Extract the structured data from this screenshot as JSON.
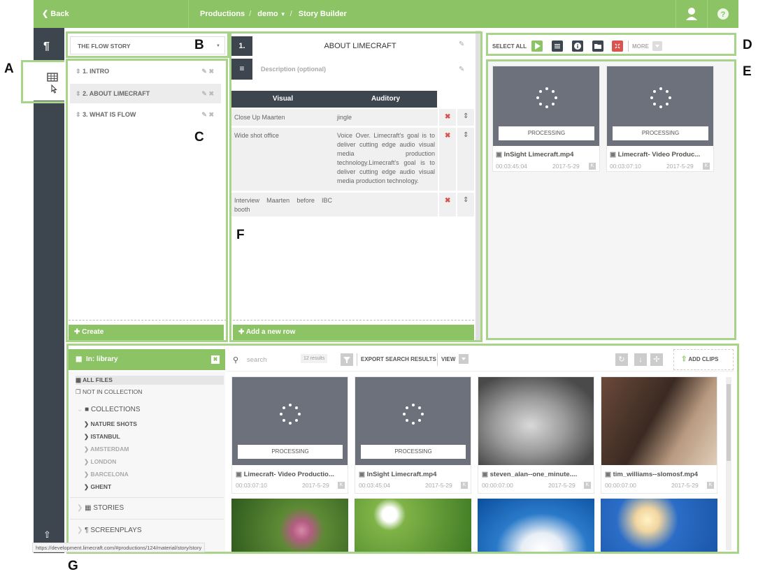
{
  "topbar": {
    "back": "Back",
    "crumb1": "Productions",
    "crumb2": "demo",
    "crumb3": "Story Builder"
  },
  "labels": {
    "A": "A",
    "B": "B",
    "C": "C",
    "D": "D",
    "E": "E",
    "F": "F",
    "G": "G"
  },
  "story_select": {
    "value": "THE FLOW STORY"
  },
  "stories": [
    {
      "label": "1. INTRO"
    },
    {
      "label": "2. ABOUT LIMECRAFT"
    },
    {
      "label": "3. WHAT IS FLOW"
    }
  ],
  "story_create": "Create",
  "scene": {
    "number": "1.",
    "title": "ABOUT LIMECRAFT",
    "desc_placeholder": "Description (optional)"
  },
  "table": {
    "headers": [
      "Visual",
      "Auditory"
    ],
    "rows": [
      {
        "visual": "Close Up Maarten",
        "auditory": "jingle"
      },
      {
        "visual": "Wide shot office",
        "auditory": "Voice Over. Limecraft's goal is to deliver cutting edge audio visual media production technology.Limecraft's goal is to deliver cutting edge audio visual media production technology."
      },
      {
        "visual": "Interview Maarten before IBC booth",
        "auditory": ""
      }
    ],
    "add_row": "Add a new row"
  },
  "toolbar_d": {
    "select_all": "SELECT ALL",
    "more": "MORE"
  },
  "clips_e": [
    {
      "status": "PROCESSING",
      "name": "InSight Limecraft.mp4",
      "duration": "00:03:45:04",
      "date": "2017-5-29",
      "badge": "K"
    },
    {
      "status": "PROCESSING",
      "name": "Limecraft- Video Produc...",
      "duration": "00:03:07:10",
      "date": "2017-5-29",
      "badge": "K"
    }
  ],
  "library": {
    "title": "In: library",
    "all_files": "ALL FILES",
    "not_in_collection": "NOT IN COLLECTION",
    "collections": "COLLECTIONS",
    "collection_items": [
      {
        "label": "NATURE SHOTS",
        "muted": false
      },
      {
        "label": "ISTANBUL",
        "muted": false
      },
      {
        "label": "AMSTERDAM",
        "muted": true
      },
      {
        "label": "LONDON",
        "muted": true
      },
      {
        "label": "BARCELONA",
        "muted": true
      },
      {
        "label": "GHENT",
        "muted": false
      }
    ],
    "stories": "STORIES",
    "screenplays": "SCREENPLAYS",
    "search_placeholder": "search",
    "results": "12 results",
    "export": "EXPORT SEARCH RESULTS",
    "view": "VIEW",
    "add_clips": "ADD CLIPS",
    "clips": [
      {
        "status": "PROCESSING",
        "name": "Limecraft- Video Productio...",
        "duration": "00:03:07:10",
        "date": "2017-5-29",
        "badge": "K"
      },
      {
        "status": "PROCESSING",
        "name": "InSight Limecraft.mp4",
        "duration": "00:03:45:04",
        "date": "2017-5-29",
        "badge": "K"
      },
      {
        "status": "",
        "name": "steven_alan--one_minute....",
        "duration": "00:00:07:00",
        "date": "2017-5-29",
        "badge": "K"
      },
      {
        "status": "",
        "name": "tim_williams--slomosf.mp4",
        "duration": "00:00:07:00",
        "date": "2017-5-29",
        "badge": "K"
      }
    ]
  },
  "status_url": "https://development.limecraft.com/#productions/124/material/story/story",
  "colors": {
    "green": "#8cc365",
    "dark": "#3d454e",
    "panel_border": "#a7d489"
  }
}
